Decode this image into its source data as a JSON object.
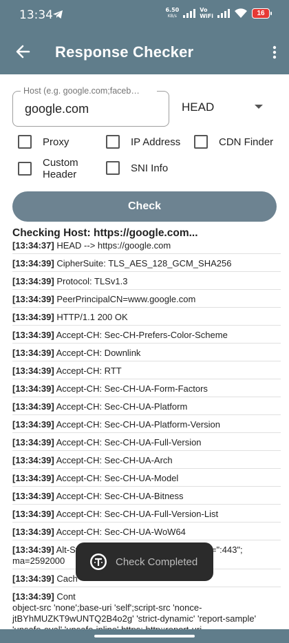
{
  "status": {
    "time": "13:34",
    "net_speed": "6.50",
    "net_unit": "KB/s",
    "vo": "Vo",
    "wifi": "WiFi",
    "battery": "16"
  },
  "appbar": {
    "title": "Response Checker"
  },
  "form": {
    "host_placeholder": "Host (e.g. google.com;faceb…",
    "host_value": "google.com",
    "method": "HEAD",
    "checkboxes": [
      {
        "label": "Proxy",
        "checked": false
      },
      {
        "label": "IP Address",
        "checked": false
      },
      {
        "label": "CDN Finder",
        "checked": false
      },
      {
        "label": "Custom Header",
        "checked": false
      },
      {
        "label": "SNI Info",
        "checked": false
      }
    ],
    "check_label": "Check"
  },
  "results": {
    "heading": "Checking Host: https://google.com...",
    "rows": [
      {
        "ts": "[13:34:37]",
        "msg": "HEAD --> https://google.com"
      },
      {
        "ts": "[13:34:39]",
        "msg": "CipherSuite: TLS_AES_128_GCM_SHA256"
      },
      {
        "ts": "[13:34:39]",
        "msg": "Protocol: TLSv1.3"
      },
      {
        "ts": "[13:34:39]",
        "msg": "PeerPrincipalCN=www.google.com"
      },
      {
        "ts": "[13:34:39]",
        "msg": "HTTP/1.1 200 OK"
      },
      {
        "ts": "[13:34:39]",
        "msg": "Accept-CH: Sec-CH-Prefers-Color-Scheme"
      },
      {
        "ts": "[13:34:39]",
        "msg": "Accept-CH: Downlink"
      },
      {
        "ts": "[13:34:39]",
        "msg": "Accept-CH: RTT"
      },
      {
        "ts": "[13:34:39]",
        "msg": "Accept-CH: Sec-CH-UA-Form-Factors"
      },
      {
        "ts": "[13:34:39]",
        "msg": "Accept-CH: Sec-CH-UA-Platform"
      },
      {
        "ts": "[13:34:39]",
        "msg": "Accept-CH: Sec-CH-UA-Platform-Version"
      },
      {
        "ts": "[13:34:39]",
        "msg": "Accept-CH: Sec-CH-UA-Full-Version"
      },
      {
        "ts": "[13:34:39]",
        "msg": "Accept-CH: Sec-CH-UA-Arch"
      },
      {
        "ts": "[13:34:39]",
        "msg": "Accept-CH: Sec-CH-UA-Model"
      },
      {
        "ts": "[13:34:39]",
        "msg": "Accept-CH: Sec-CH-UA-Bitness"
      },
      {
        "ts": "[13:34:39]",
        "msg": "Accept-CH: Sec-CH-UA-Full-Version-List"
      },
      {
        "ts": "[13:34:39]",
        "msg": "Accept-CH: Sec-CH-UA-WoW64"
      },
      {
        "ts": "[13:34:39]",
        "msg": "Alt-Svc: h3=\":443\"; ma=2592000,h3-29=\":443\"; ma=2592000"
      },
      {
        "ts": "[13:34:39]",
        "msg": "Cach"
      },
      {
        "ts": "[13:34:39]",
        "msg": "Cont"
      }
    ],
    "csp_continuation": "object-src 'none';base-uri 'self';script-src 'nonce-jtBYhMUZKT9wUNTQ2B4o2g' 'strict-dynamic' 'report-sample' 'unsafe-eval' 'unsafe-inline' https: http:;report-uri https://csp.withgoogle.com/csp/gws/other-hp"
  },
  "toast": {
    "text": "Check Completed"
  },
  "colors": {
    "primary": "#607d8b",
    "button": "#6d8391",
    "battery_low": "#e53935"
  }
}
